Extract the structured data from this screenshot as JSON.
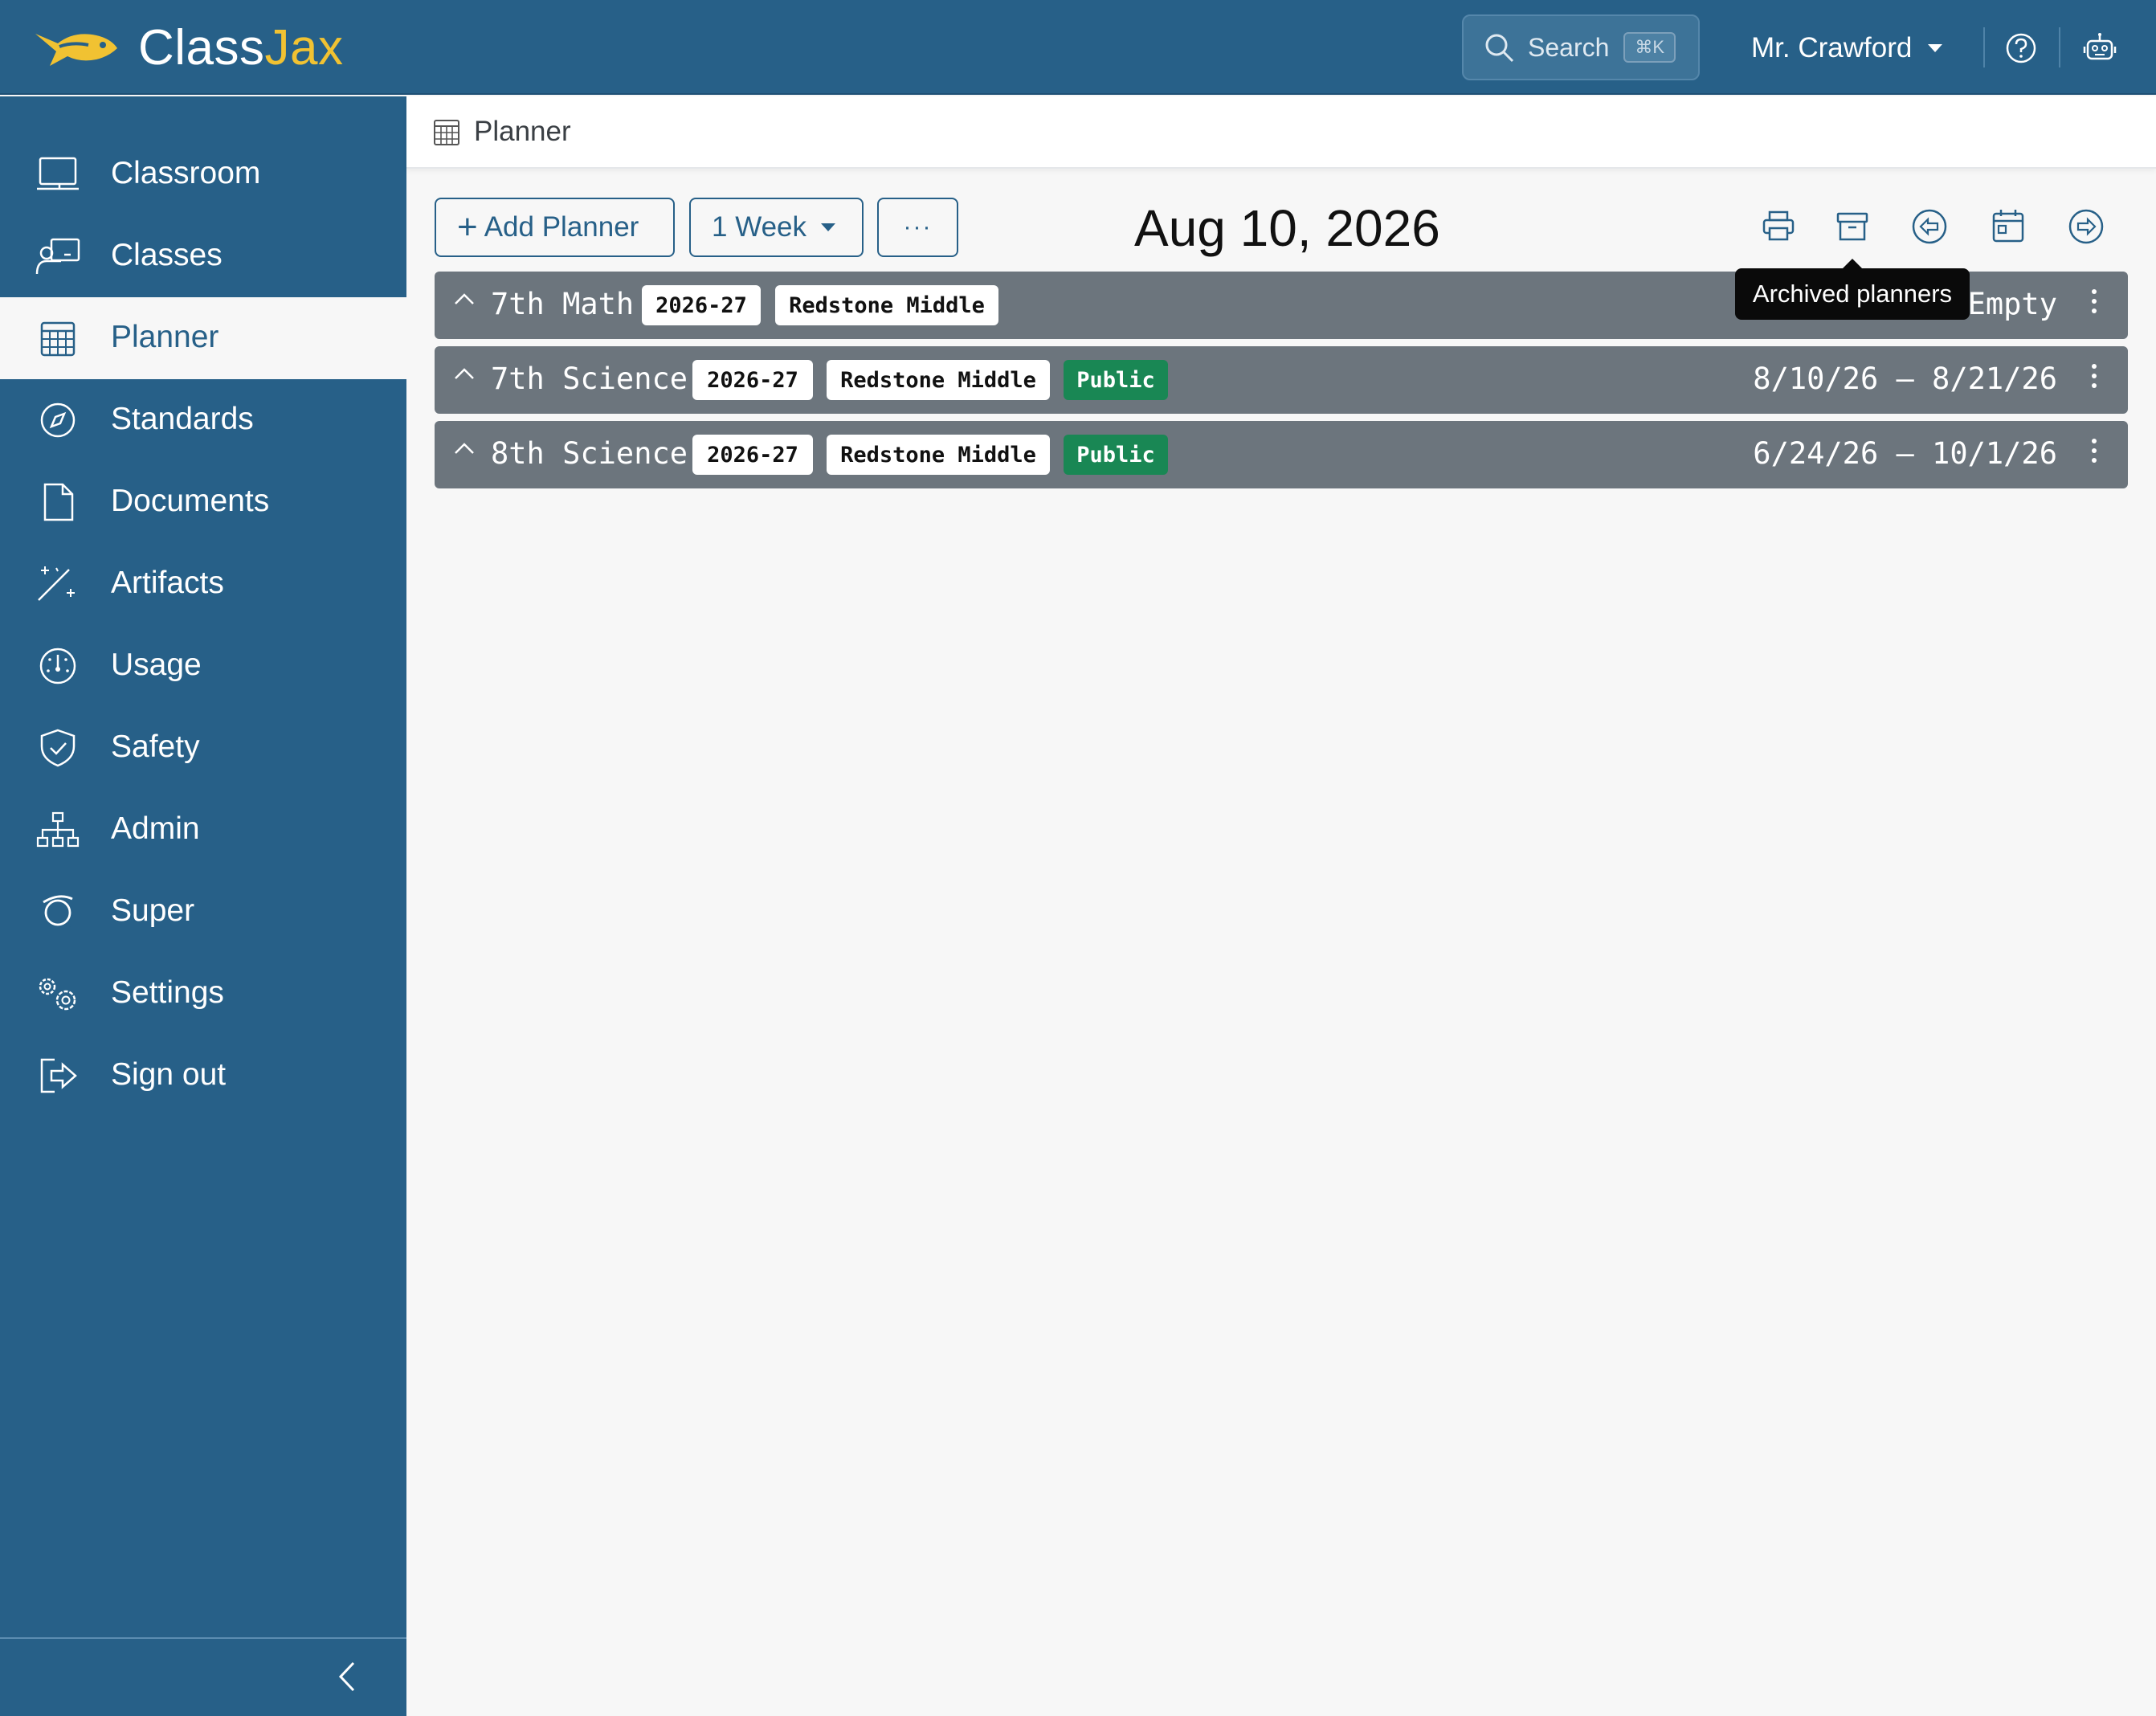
{
  "app": {
    "logo_part1": "Class",
    "logo_part2": "Jax",
    "search_label": "Search",
    "search_shortcut": "⌘K",
    "user_name": "Mr. Crawford",
    "brand_color": "#276088",
    "accent_color": "#f1c232"
  },
  "sidebar": {
    "items": [
      {
        "label": "Classroom",
        "icon": "laptop-icon"
      },
      {
        "label": "Classes",
        "icon": "teacher-board-icon"
      },
      {
        "label": "Planner",
        "icon": "calendar-grid-icon",
        "active": true
      },
      {
        "label": "Standards",
        "icon": "compass-icon"
      },
      {
        "label": "Documents",
        "icon": "file-icon"
      },
      {
        "label": "Artifacts",
        "icon": "magic-wand-icon"
      },
      {
        "label": "Usage",
        "icon": "speedometer-icon"
      },
      {
        "label": "Safety",
        "icon": "shield-check-icon"
      },
      {
        "label": "Admin",
        "icon": "org-chart-icon"
      },
      {
        "label": "Super",
        "icon": "orbit-icon"
      },
      {
        "label": "Settings",
        "icon": "gears-icon"
      },
      {
        "label": "Sign out",
        "icon": "sign-out-icon"
      }
    ]
  },
  "breadcrumb": {
    "label": "Planner"
  },
  "toolbar": {
    "add_label": "Add Planner",
    "add_symbol": "+",
    "range_label": "1 Week",
    "more_label": "···",
    "current_date": "Aug 10, 2026",
    "tooltip": "Archived planners"
  },
  "planners": [
    {
      "name": "7th Math",
      "year": "2026-27",
      "school": "Redstone Middle",
      "public": "",
      "range": "Empty"
    },
    {
      "name": "7th Science",
      "year": "2026-27",
      "school": "Redstone Middle",
      "public": "Public",
      "range": "8/10/26 – 8/21/26"
    },
    {
      "name": "8th Science",
      "year": "2026-27",
      "school": "Redstone Middle",
      "public": "Public",
      "range": "6/24/26 – 10/1/26"
    }
  ]
}
